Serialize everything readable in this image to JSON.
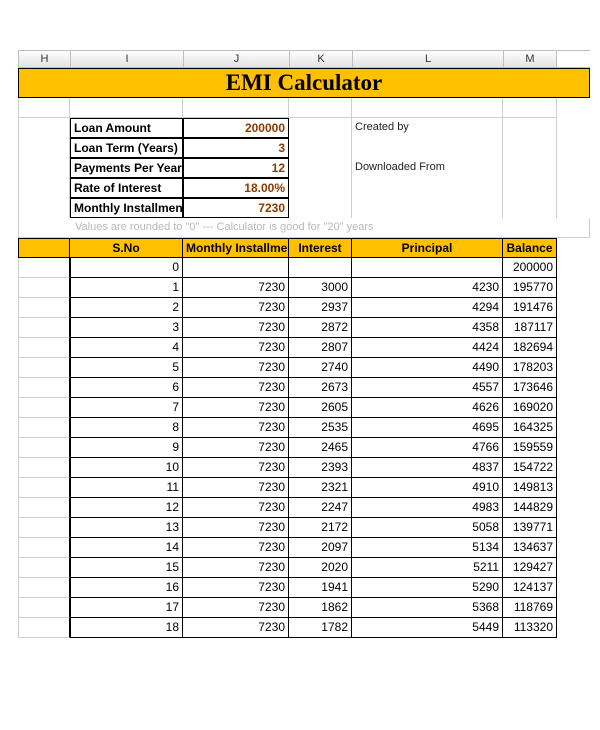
{
  "columns": [
    "H",
    "I",
    "J",
    "K",
    "L",
    "M"
  ],
  "title": "EMI Calculator",
  "params": {
    "loan_amount_label": "Loan Amount",
    "loan_amount": "200000",
    "loan_term_label": "Loan Term (Years)",
    "loan_term": "3",
    "ppy_label": "Payments Per Year",
    "ppy": "12",
    "roi_label": "Rate of Interest",
    "roi": "18.00%",
    "emi_label": "Monthly Installment",
    "emi": "7230"
  },
  "side": {
    "created_by": "Created by",
    "downloaded_from": "Downloaded From"
  },
  "note": "Values are rounded to \"0\"  ---  Calculator is good for \"20\" years",
  "headers": {
    "sno": "S.No",
    "installment": "Monthly Installment",
    "interest": "Interest",
    "principal": "Principal",
    "balance": "Balance"
  },
  "rows": [
    {
      "sno": "0",
      "inst": "",
      "int": "",
      "prin": "",
      "bal": "200000"
    },
    {
      "sno": "1",
      "inst": "7230",
      "int": "3000",
      "prin": "4230",
      "bal": "195770"
    },
    {
      "sno": "2",
      "inst": "7230",
      "int": "2937",
      "prin": "4294",
      "bal": "191476"
    },
    {
      "sno": "3",
      "inst": "7230",
      "int": "2872",
      "prin": "4358",
      "bal": "187117"
    },
    {
      "sno": "4",
      "inst": "7230",
      "int": "2807",
      "prin": "4424",
      "bal": "182694"
    },
    {
      "sno": "5",
      "inst": "7230",
      "int": "2740",
      "prin": "4490",
      "bal": "178203"
    },
    {
      "sno": "6",
      "inst": "7230",
      "int": "2673",
      "prin": "4557",
      "bal": "173646"
    },
    {
      "sno": "7",
      "inst": "7230",
      "int": "2605",
      "prin": "4626",
      "bal": "169020"
    },
    {
      "sno": "8",
      "inst": "7230",
      "int": "2535",
      "prin": "4695",
      "bal": "164325"
    },
    {
      "sno": "9",
      "inst": "7230",
      "int": "2465",
      "prin": "4766",
      "bal": "159559"
    },
    {
      "sno": "10",
      "inst": "7230",
      "int": "2393",
      "prin": "4837",
      "bal": "154722"
    },
    {
      "sno": "11",
      "inst": "7230",
      "int": "2321",
      "prin": "4910",
      "bal": "149813"
    },
    {
      "sno": "12",
      "inst": "7230",
      "int": "2247",
      "prin": "4983",
      "bal": "144829"
    },
    {
      "sno": "13",
      "inst": "7230",
      "int": "2172",
      "prin": "5058",
      "bal": "139771"
    },
    {
      "sno": "14",
      "inst": "7230",
      "int": "2097",
      "prin": "5134",
      "bal": "134637"
    },
    {
      "sno": "15",
      "inst": "7230",
      "int": "2020",
      "prin": "5211",
      "bal": "129427"
    },
    {
      "sno": "16",
      "inst": "7230",
      "int": "1941",
      "prin": "5290",
      "bal": "124137"
    },
    {
      "sno": "17",
      "inst": "7230",
      "int": "1862",
      "prin": "5368",
      "bal": "118769"
    },
    {
      "sno": "18",
      "inst": "7230",
      "int": "1782",
      "prin": "5449",
      "bal": "113320"
    }
  ]
}
